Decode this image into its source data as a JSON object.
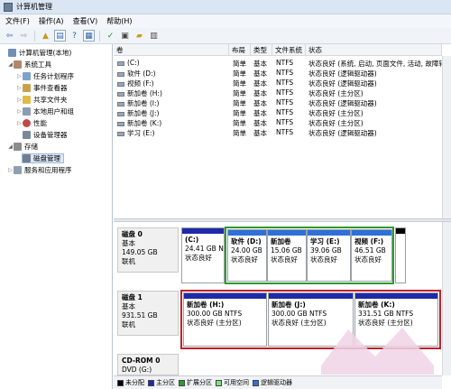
{
  "window": {
    "title": "计算机管理"
  },
  "menu": [
    "文件(F)",
    "操作(A)",
    "查看(V)",
    "帮助(H)"
  ],
  "tree": [
    {
      "label": "计算机管理(本地)",
      "indent": 0,
      "expander": "",
      "icon": "computer-icon"
    },
    {
      "label": "系统工具",
      "indent": 1,
      "expander": "◢",
      "icon": "tools-icon"
    },
    {
      "label": "任务计划程序",
      "indent": 2,
      "expander": "▷",
      "icon": "clock-icon"
    },
    {
      "label": "事件查看器",
      "indent": 2,
      "expander": "▷",
      "icon": "event-icon"
    },
    {
      "label": "共享文件夹",
      "indent": 2,
      "expander": "▷",
      "icon": "folder-icon"
    },
    {
      "label": "本地用户和组",
      "indent": 2,
      "expander": "▷",
      "icon": "users-icon"
    },
    {
      "label": "性能",
      "indent": 2,
      "expander": "▷",
      "icon": "performance-icon"
    },
    {
      "label": "设备管理器",
      "indent": 2,
      "expander": "",
      "icon": "device-icon"
    },
    {
      "label": "存储",
      "indent": 1,
      "expander": "◢",
      "icon": "storage-icon"
    },
    {
      "label": "磁盘管理",
      "indent": 2,
      "expander": "",
      "icon": "disk-icon",
      "selected": true
    },
    {
      "label": "服务和应用程序",
      "indent": 1,
      "expander": "▷",
      "icon": "services-icon"
    }
  ],
  "columns": [
    "卷",
    "布局",
    "类型",
    "文件系统",
    "状态"
  ],
  "volumes": [
    {
      "vol": "(C:)",
      "layout": "简单",
      "type": "基本",
      "fs": "NTFS",
      "status": "状态良好 (系统, 启动, 页面文件, 活动, 故障转储"
    },
    {
      "vol": "软件 (D:)",
      "layout": "简单",
      "type": "基本",
      "fs": "NTFS",
      "status": "状态良好 (逻辑驱动器)"
    },
    {
      "vol": "视频 (F:)",
      "layout": "简单",
      "type": "基本",
      "fs": "NTFS",
      "status": "状态良好 (逻辑驱动器)"
    },
    {
      "vol": "新加卷 (H:)",
      "layout": "简单",
      "type": "基本",
      "fs": "NTFS",
      "status": "状态良好 (主分区)"
    },
    {
      "vol": "新加卷 (I:)",
      "layout": "简单",
      "type": "基本",
      "fs": "NTFS",
      "status": "状态良好 (逻辑驱动器)"
    },
    {
      "vol": "新加卷 (J:)",
      "layout": "简单",
      "type": "基本",
      "fs": "NTFS",
      "status": "状态良好 (主分区)"
    },
    {
      "vol": "新加卷 (K:)",
      "layout": "简单",
      "type": "基本",
      "fs": "NTFS",
      "status": "状态良好 (主分区)"
    },
    {
      "vol": "学习 (E:)",
      "layout": "简单",
      "type": "基本",
      "fs": "NTFS",
      "status": "状态良好 (逻辑驱动器)"
    }
  ],
  "disks": [
    {
      "name": "磁盘 0",
      "kind": "基本",
      "size": "149.05 GB",
      "state": "联机"
    },
    {
      "name": "磁盘 1",
      "kind": "基本",
      "size": "931.51 GB",
      "state": "联机"
    },
    {
      "name": "CD-ROM 0",
      "kind": "DVD (G:)",
      "size": "",
      "state": ""
    }
  ],
  "disk0_parts": [
    {
      "name": "(C:)",
      "size": "24.41 GB N",
      "status": "状态良好"
    },
    {
      "name": "软件 (D:)",
      "size": "24.00 GB",
      "status": "状态良好"
    },
    {
      "name": "新加卷",
      "size": "15.06 GB",
      "status": "状态良好"
    },
    {
      "name": "学习 (E:)",
      "size": "39.06 GB",
      "status": "状态良好"
    },
    {
      "name": "视频 (F:)",
      "size": "46.51 GB",
      "status": "状态良好"
    }
  ],
  "disk1_parts": [
    {
      "name": "新加卷 (H:)",
      "size": "300.00 GB NTFS",
      "status": "状态良好 (主分区)"
    },
    {
      "name": "新加卷 (J:)",
      "size": "300.00 GB NTFS",
      "status": "状态良好 (主分区)"
    },
    {
      "name": "新加卷 (K:)",
      "size": "331.51 GB NTFS",
      "status": "状态良好 (主分区)"
    }
  ],
  "legend": [
    {
      "label": "未分配",
      "color": "#000000"
    },
    {
      "label": "主分区",
      "color": "#1f2aa8"
    },
    {
      "label": "扩展分区",
      "color": "#2e9a2e"
    },
    {
      "label": "可用空间",
      "color": "#7fe07f"
    },
    {
      "label": "逻辑驱动器",
      "color": "#2f6fd8"
    }
  ],
  "colors": {
    "primary": "#1f2aa8",
    "logical": "#2f6fd8",
    "extended": "#2e9a2e",
    "highlight_red": "#c0202a"
  }
}
